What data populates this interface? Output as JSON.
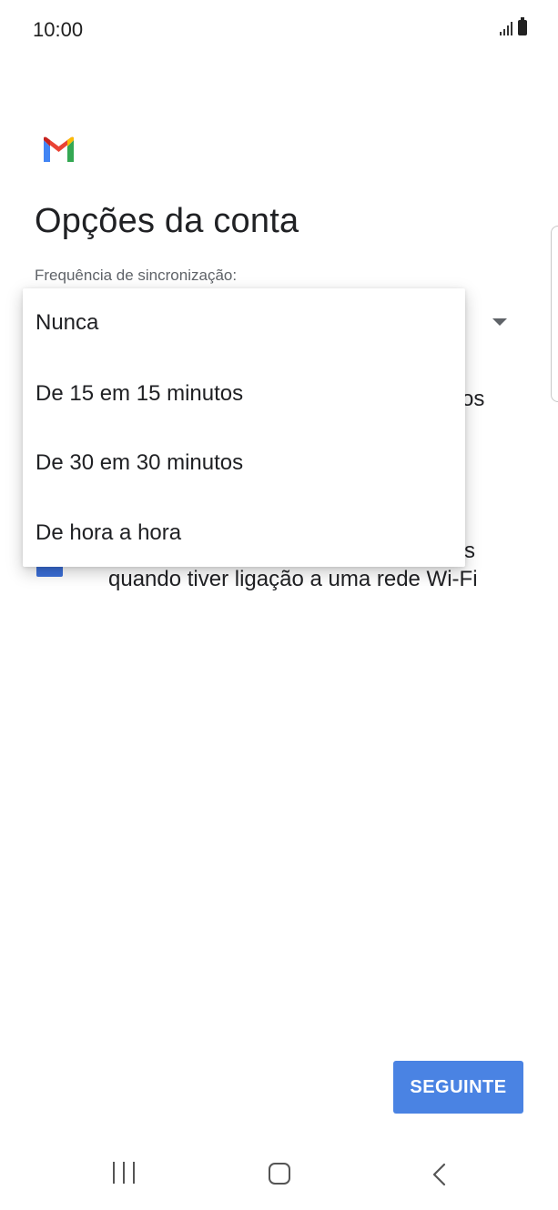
{
  "status_bar": {
    "time": "10:00",
    "icons": [
      "signal-icon",
      "battery-icon"
    ]
  },
  "header": {
    "logo": "gmail-logo",
    "title": "Opções da conta"
  },
  "sync": {
    "label": "Frequência de sincronização:",
    "dropdown_icon": "dropdown-arrow-icon",
    "options": [
      "Nunca",
      "De 15 em 15 minutos",
      "De 30 em 30 minutos",
      "De hora a hora"
    ]
  },
  "background_text": {
    "line1_fragment": "os",
    "line2_fragment": "s",
    "line3": "quando tiver ligação a uma rede Wi-Fi"
  },
  "actions": {
    "next_label": "SEGUINTE"
  },
  "colors": {
    "accent": "#4a83e3",
    "checkbox": "#3b6fd8",
    "gmail_red": "#ea4335",
    "gmail_blue": "#4285f4",
    "gmail_green": "#34a853",
    "gmail_yellow": "#fbbc04"
  },
  "nav_bar": {
    "icons": [
      "recents-icon",
      "home-icon",
      "back-icon"
    ]
  }
}
